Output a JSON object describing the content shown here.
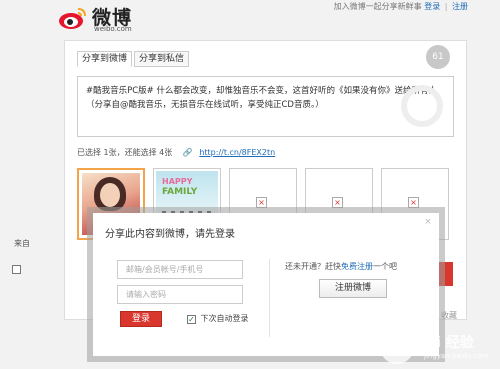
{
  "header": {
    "logo_text": "微博",
    "logo_url": "weibo.com",
    "prompt_text": "加入微博一起分享新鲜事",
    "login_link": "登录",
    "separator": "|",
    "register_link": "注册"
  },
  "share": {
    "tabs": [
      {
        "label": "分享到微博",
        "active": true
      },
      {
        "label": "分享到私信",
        "active": false
      }
    ],
    "char_counter": "61",
    "message": "#酷我音乐PC版# 什么都会改变，却惟独音乐不会变，这首好听的《如果没有你》送给所有人（分享自@酷我音乐，无损音乐在线试听，享受纯正CD音质。）",
    "selected_info": "已选择 1张，还能选择 4张",
    "short_link": "http://t.cn/8FEX2tn",
    "thumbnails": [
      {
        "type": "album",
        "selected": true
      },
      {
        "type": "album",
        "selected": false,
        "text_line1": "HAPPY",
        "text_line2": "FAMILY"
      },
      {
        "type": "broken",
        "selected": false
      },
      {
        "type": "broken",
        "selected": false
      },
      {
        "type": "broken",
        "selected": false
      }
    ],
    "under_label": "来自",
    "broken_glyph": "×",
    "fav_text": "收藏"
  },
  "login_modal": {
    "title": "分享此内容到微博，请先登录",
    "close_glyph": "×",
    "account_placeholder": "邮箱/会员帐号/手机号",
    "password_placeholder": "请输入密码",
    "login_button": "登录",
    "auto_login_label": "下次自动登录",
    "auto_login_checked": true,
    "check_glyph": "✓",
    "not_registered_text": "还未开通？赶快",
    "register_link": "免费注册",
    "register_suffix": "一个吧",
    "register_button": "注册微博"
  },
  "watermark": {
    "text": "Bai 经验",
    "sub": "jingyan.baidu.com"
  },
  "colors": {
    "brand_red": "#d9362d",
    "link_blue": "#1e6bb8",
    "selected_border": "#f3a34a"
  }
}
